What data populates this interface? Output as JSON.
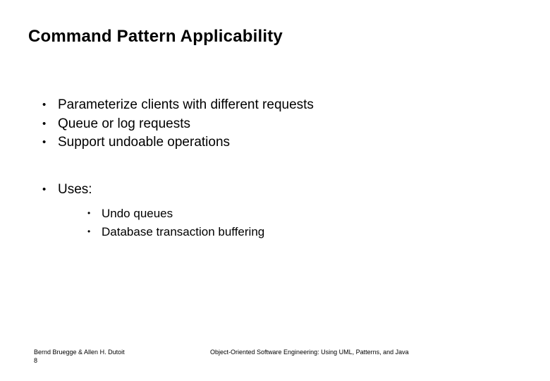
{
  "title": "Command Pattern  Applicability",
  "bullets": {
    "b1": "Parameterize clients with different requests",
    "b2": "Queue or log requests",
    "b3": "Support undoable operations",
    "b4": "Uses:"
  },
  "subbullets": {
    "s1": "Undo queues",
    "s2": "Database transaction buffering"
  },
  "footer": {
    "authors": "Bernd Bruegge & Allen H. Dutoit",
    "page": "8",
    "book": "Object-Oriented Software Engineering: Using UML, Patterns, and Java"
  }
}
